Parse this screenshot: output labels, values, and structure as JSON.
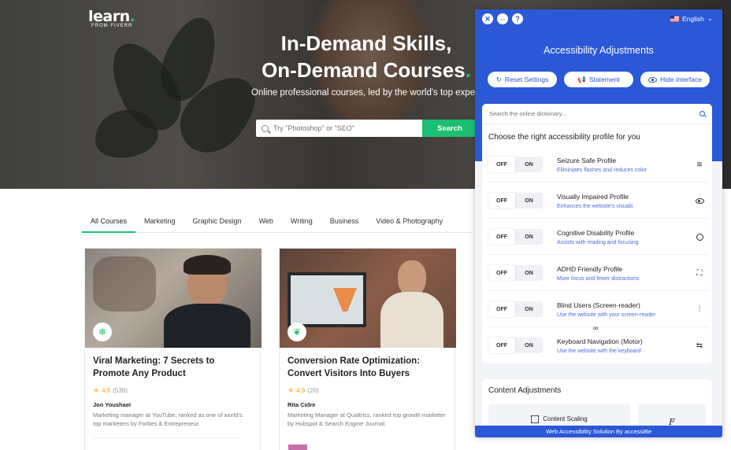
{
  "site": {
    "logo_main": "learn",
    "logo_sub": "FROM FIVERR",
    "hero_title_line1": "In-Demand Skills,",
    "hero_title_line2": "On-Demand Courses",
    "hero_subtitle": "Online professional courses, led by the world's top experts",
    "search_placeholder": "Try \"Photoshop\" or \"SEO\"",
    "search_button": "Search",
    "accent_color": "#1dbf73"
  },
  "tabs": [
    {
      "label": "All Courses",
      "active": true
    },
    {
      "label": "Marketing"
    },
    {
      "label": "Graphic Design"
    },
    {
      "label": "Web"
    },
    {
      "label": "Writing"
    },
    {
      "label": "Business"
    },
    {
      "label": "Video & Photography"
    }
  ],
  "courses": [
    {
      "title": "Viral Marketing: 7 Secrets to Promote Any Product",
      "rating": "4.9",
      "reviews": "(539)",
      "author": "Jon Youshaei",
      "description": "Marketing manager at YouTube, ranked as one of world's top marketers by Forbes & Entrepreneur.",
      "badge_icon": "snowflake-icon"
    },
    {
      "title": "Conversion Rate Optimization: Convert Visitors Into Buyers",
      "rating": "4.9",
      "reviews": "(20)",
      "author": "Rita Cidre",
      "description": "Marketing Manager at Qualtrics, ranked top growth marketer by Hubspot & Search Engine Journal.",
      "badge_icon": "leaf-icon"
    }
  ],
  "accessibility": {
    "language": "English",
    "title": "Accessibility Adjustments",
    "reset_label": "Reset Settings",
    "statement_label": "Statement",
    "hide_label": "Hide Interface",
    "dictionary_placeholder": "Search the online dictionary...",
    "choose_heading": "Choose the right accessibility profile for you",
    "toggle_off": "OFF",
    "toggle_on": "ON",
    "profiles": [
      {
        "name": "Seizure Safe Profile",
        "desc": "Eliminates flashes and reduces color",
        "icon": "bolt-icon"
      },
      {
        "name": "Visually Impaired Profile",
        "desc": "Enhances the website's visuals",
        "icon": "eye-icon"
      },
      {
        "name": "Cognitive Disability Profile",
        "desc": "Assists with reading and focusing",
        "icon": "circle-icon"
      },
      {
        "name": "ADHD Friendly Profile",
        "desc": "More focus and fewer distractions",
        "icon": "focus-icon"
      },
      {
        "name": "Blind Users (Screen-reader)",
        "desc": "Use the website with your screen-reader",
        "icon": "audio-wave-icon"
      },
      {
        "name": "Keyboard Navigation (Motor)",
        "desc": "Use the website with the keyboard",
        "icon": "arrows-icon"
      }
    ],
    "content_heading": "Content Adjustments",
    "content_scaling": "Content Scaling",
    "footer": "Web Accessibility Solution By accessiBe",
    "brand_color": "#2a58d6"
  }
}
